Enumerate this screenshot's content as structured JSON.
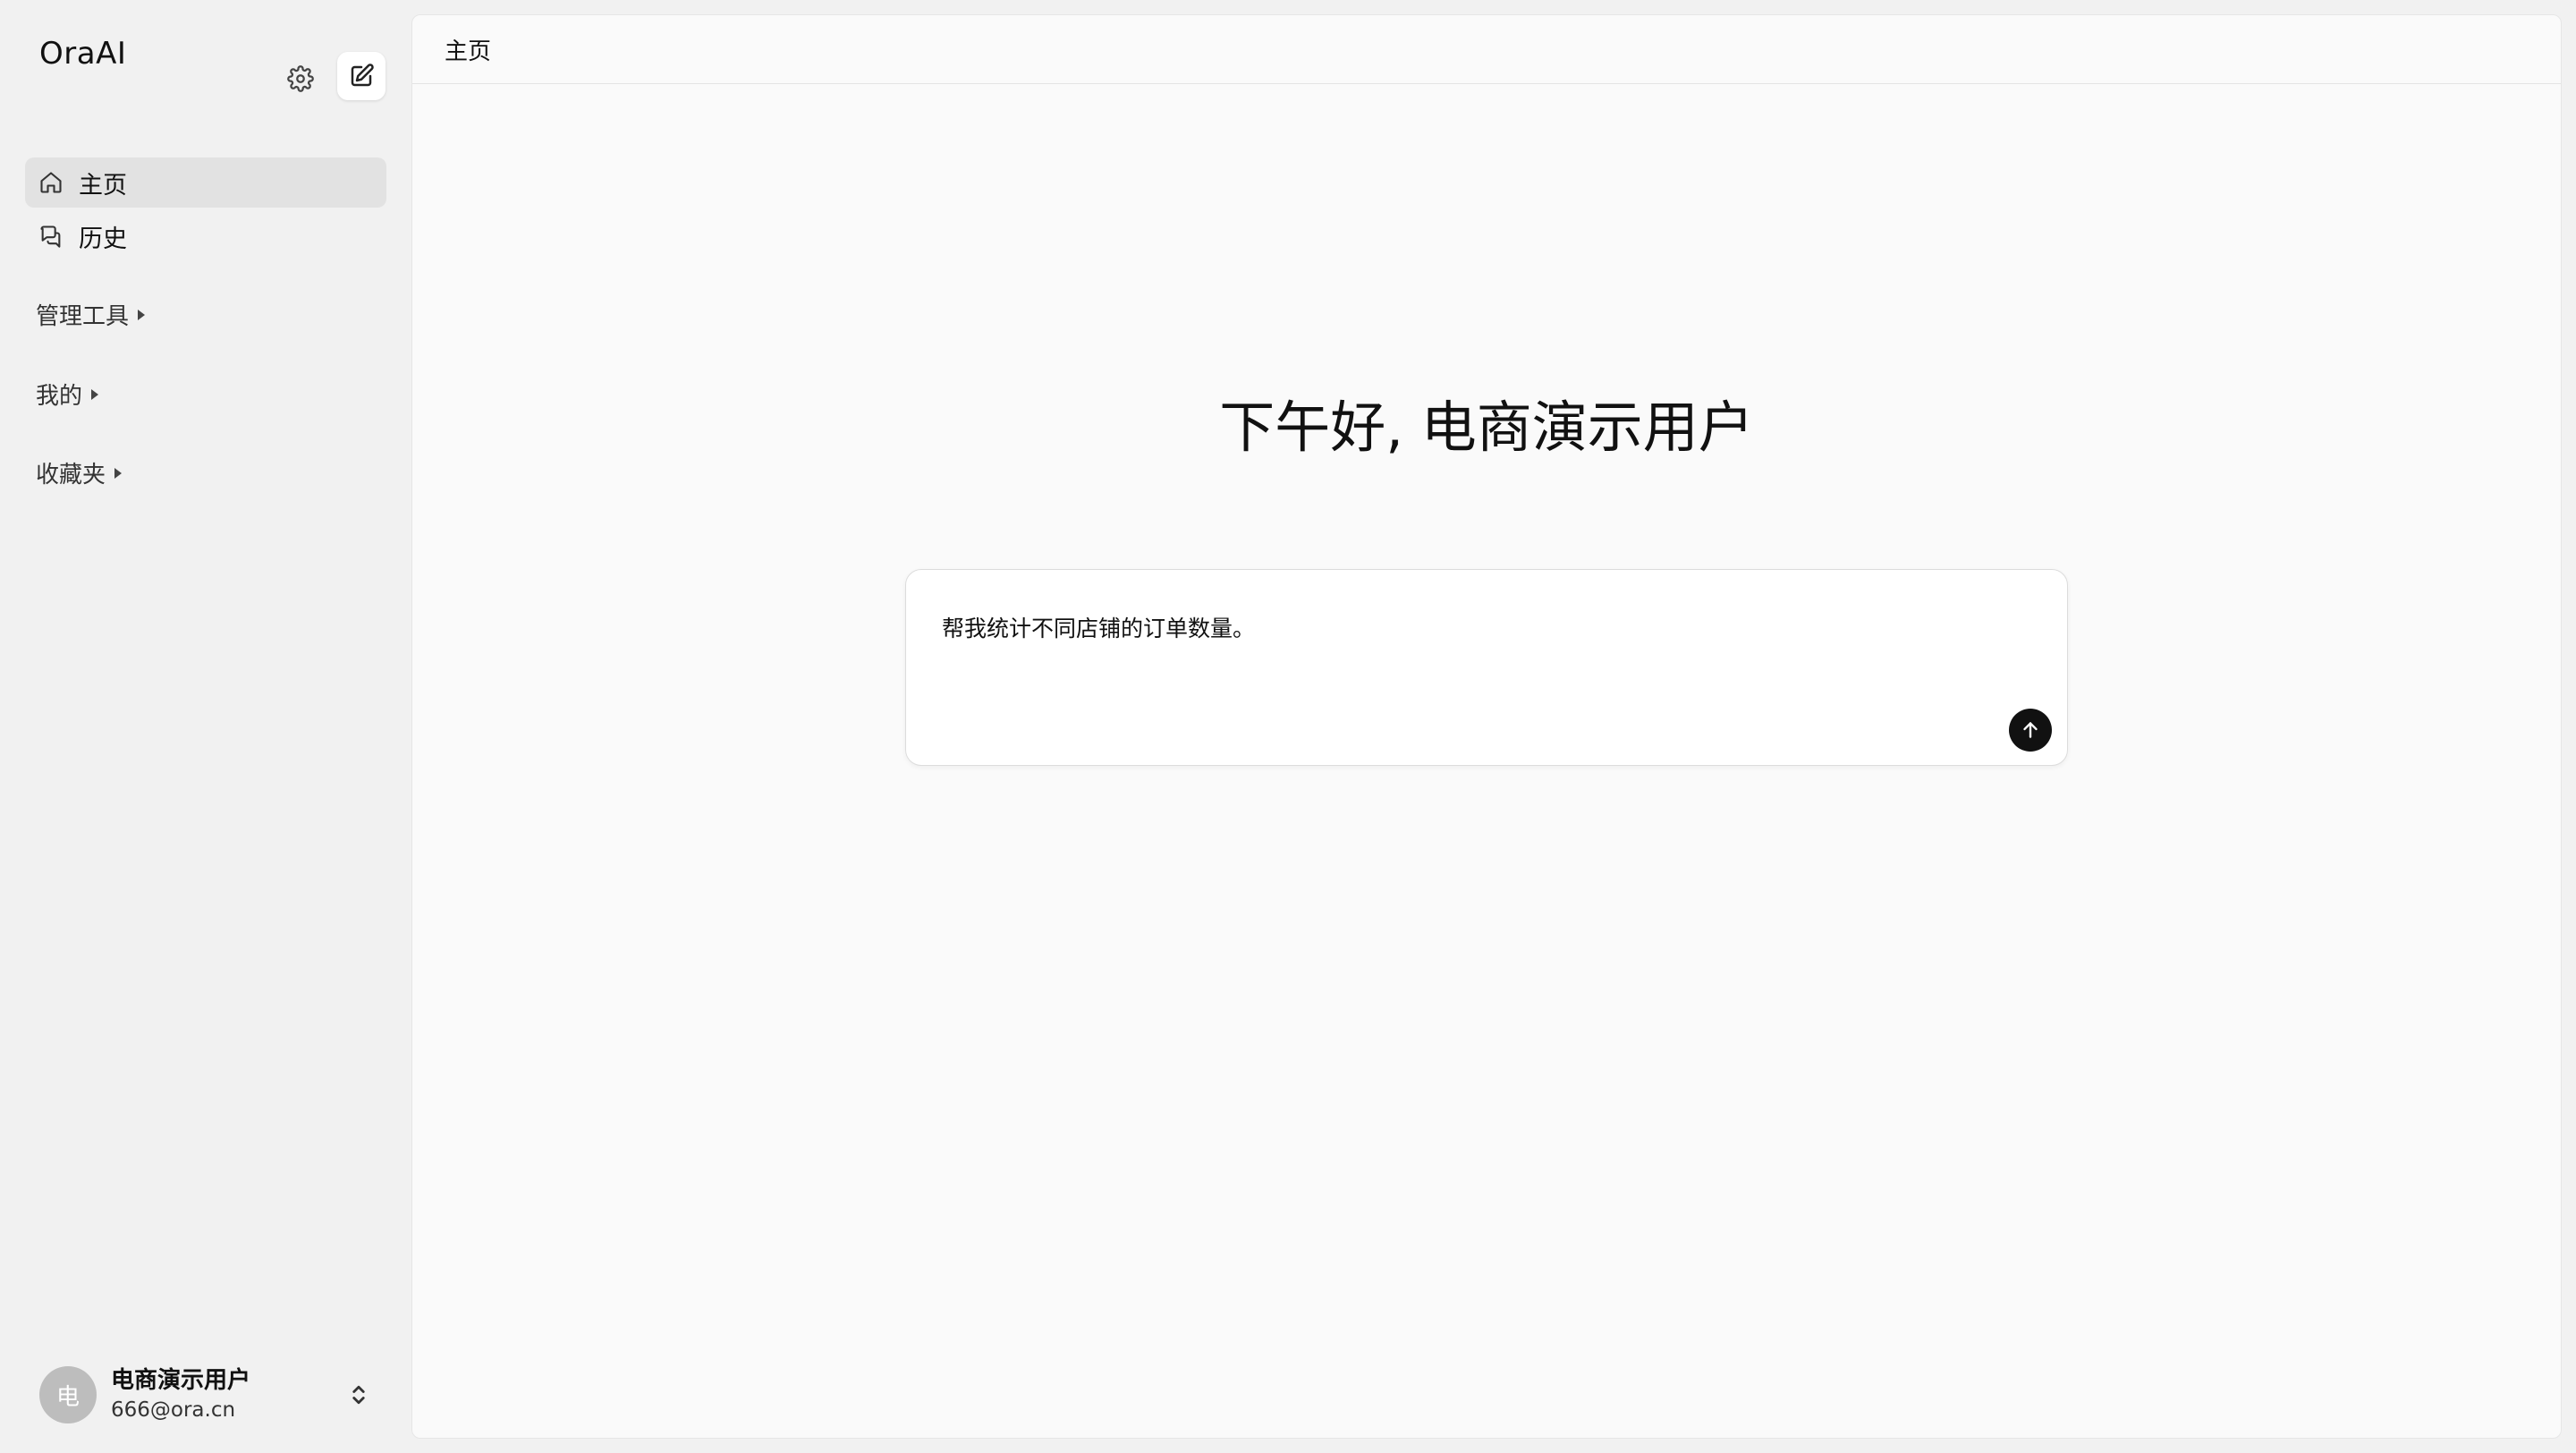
{
  "app": {
    "brand": "OraAI"
  },
  "header": {
    "breadcrumb": "主页"
  },
  "sidebar": {
    "nav": [
      {
        "label": "主页",
        "icon": "home-icon",
        "active": true
      },
      {
        "label": "历史",
        "icon": "chat-history-icon",
        "active": false
      }
    ],
    "sections": [
      {
        "label": "管理工具"
      },
      {
        "label": "我的"
      },
      {
        "label": "收藏夹"
      }
    ],
    "user": {
      "avatar_text": "电",
      "name": "电商演示用户",
      "email": "666@ora.cn"
    }
  },
  "main": {
    "greeting": "下午好, 电商演示用户",
    "composer": {
      "text": "帮我统计不同店铺的订单数量。"
    }
  }
}
